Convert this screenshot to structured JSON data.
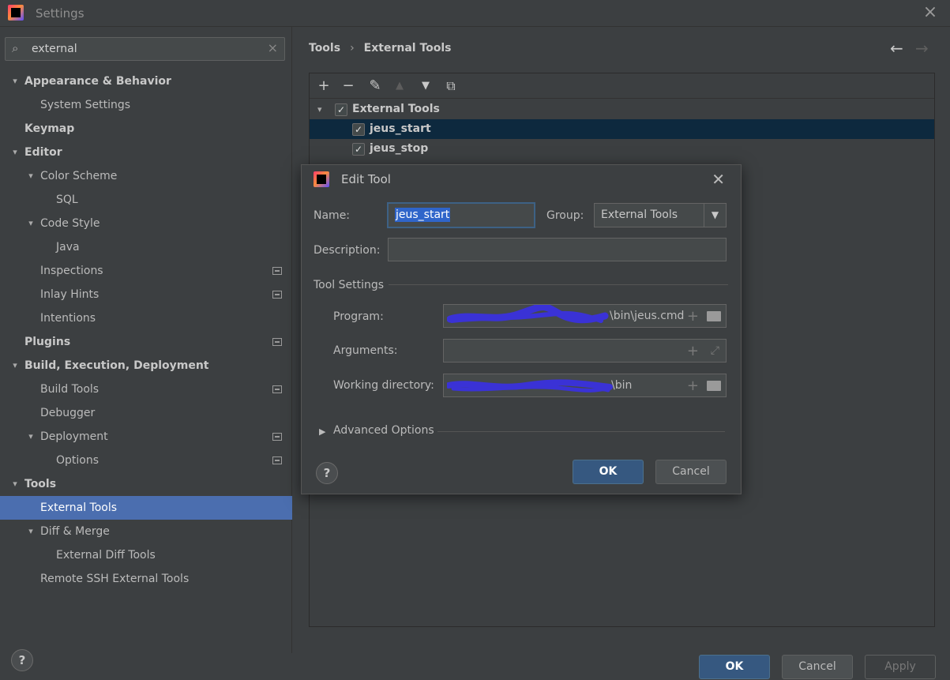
{
  "window": {
    "title": "Settings",
    "logo_icon": "intellij-logo-icon",
    "close_icon": "close-icon"
  },
  "search": {
    "value": "external",
    "icon": "search-icon",
    "clear_icon": "clear-icon"
  },
  "sidebar": {
    "items": [
      {
        "label": "Appearance & Behavior",
        "bold": true,
        "level": 0,
        "expanded": true
      },
      {
        "label": "System Settings",
        "bold": false,
        "level": 1,
        "expanded": null
      },
      {
        "label": "Keymap",
        "bold": true,
        "level": 0,
        "expanded": null
      },
      {
        "label": "Editor",
        "bold": true,
        "level": 0,
        "expanded": true
      },
      {
        "label": "Color Scheme",
        "bold": false,
        "level": 1,
        "expanded": true
      },
      {
        "label": "SQL",
        "bold": false,
        "level": 2,
        "expanded": null
      },
      {
        "label": "Code Style",
        "bold": false,
        "level": 1,
        "expanded": true
      },
      {
        "label": "Java",
        "bold": false,
        "level": 2,
        "expanded": null
      },
      {
        "label": "Inspections",
        "bold": false,
        "level": 1,
        "expanded": null,
        "project_icon": true
      },
      {
        "label": "Inlay Hints",
        "bold": false,
        "level": 1,
        "expanded": null,
        "project_icon": true
      },
      {
        "label": "Intentions",
        "bold": false,
        "level": 1,
        "expanded": null
      },
      {
        "label": "Plugins",
        "bold": true,
        "level": 0,
        "expanded": null,
        "project_icon": true
      },
      {
        "label": "Build, Execution, Deployment",
        "bold": true,
        "level": 0,
        "expanded": true
      },
      {
        "label": "Build Tools",
        "bold": false,
        "level": 1,
        "expanded": null,
        "project_icon": true
      },
      {
        "label": "Debugger",
        "bold": false,
        "level": 1,
        "expanded": null
      },
      {
        "label": "Deployment",
        "bold": false,
        "level": 1,
        "expanded": true,
        "project_icon": true
      },
      {
        "label": "Options",
        "bold": false,
        "level": 2,
        "expanded": null,
        "project_icon": true
      },
      {
        "label": "Tools",
        "bold": true,
        "level": 0,
        "expanded": true
      },
      {
        "label": "External Tools",
        "bold": false,
        "level": 1,
        "expanded": null,
        "selected": true
      },
      {
        "label": "Diff & Merge",
        "bold": false,
        "level": 1,
        "expanded": true
      },
      {
        "label": "External Diff Tools",
        "bold": false,
        "level": 2,
        "expanded": null
      },
      {
        "label": "Remote SSH External Tools",
        "bold": false,
        "level": 1,
        "expanded": null
      }
    ]
  },
  "breadcrumb": {
    "part1": "Tools",
    "separator": "›",
    "part2": "External Tools",
    "back_icon": "←",
    "forward_icon": "→"
  },
  "toolbar": {
    "add": "+",
    "remove": "−",
    "edit": "✎",
    "move_up": "▲",
    "move_down": "▼",
    "copy": "⧉"
  },
  "tool_tree": {
    "group": {
      "label": "External Tools",
      "checked": true
    },
    "items": [
      {
        "label": "jeus_start",
        "checked": true,
        "selected": true
      },
      {
        "label": "jeus_stop",
        "checked": true,
        "selected": false
      }
    ]
  },
  "dialog": {
    "title": "Edit Tool",
    "name_label": "Name:",
    "name_value": "jeus_start",
    "group_label": "Group:",
    "group_value": "External Tools",
    "description_label": "Description:",
    "description_value": "",
    "tool_settings_label": "Tool Settings",
    "program_label": "Program:",
    "program_value": "\\bin\\jeus.cmd",
    "arguments_label": "Arguments:",
    "arguments_value": "",
    "working_dir_label": "Working directory:",
    "working_dir_value": "\\bin",
    "advanced_label": "Advanced Options",
    "ok_label": "OK",
    "cancel_label": "Cancel",
    "help_label": "?",
    "redaction_color": "#3333cc"
  },
  "footer": {
    "help_label": "?",
    "ok_label": "OK",
    "cancel_label": "Cancel",
    "apply_label": "Apply"
  },
  "colors": {
    "selection": "#4b6eaf",
    "primary_button": "#365880",
    "background": "#3c3f41"
  }
}
